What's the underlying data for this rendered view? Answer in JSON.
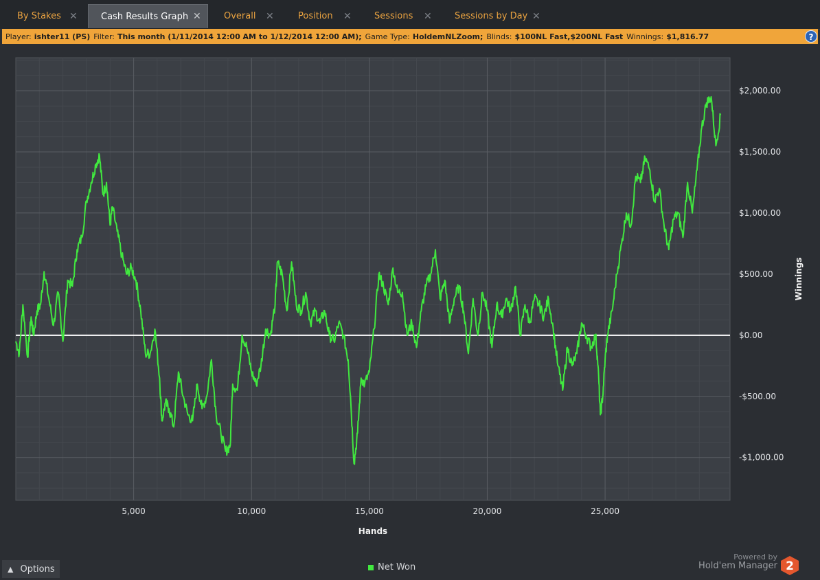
{
  "tabs": [
    {
      "label": "By Stakes",
      "active": false
    },
    {
      "label": "Cash Results Graph",
      "active": true
    },
    {
      "label": "Overall",
      "active": false
    },
    {
      "label": "Position",
      "active": false
    },
    {
      "label": "Sessions",
      "active": false
    },
    {
      "label": "Sessions by Day",
      "active": false
    }
  ],
  "filter": {
    "player_label": "Player:",
    "player_value": "ishter11 (PS)",
    "filter_label": "Filter:",
    "filter_value": "This month (1/11/2014 12:00 AM to 1/12/2014 12:00 AM);",
    "gametype_label": "Game Type:",
    "gametype_value": "HoldemNLZoom;",
    "blinds_label": "Blinds:",
    "blinds_value": "$100NL Fast,$200NL Fast",
    "winnings_label": "Winnings:",
    "winnings_value": "$1,816.77"
  },
  "help_label": "?",
  "options_label": "Options",
  "powered_by": "Powered by",
  "brand": "Hold'em Manager",
  "brand_badge": "2",
  "colors": {
    "line": "#41e83f",
    "zero": "#ffffff",
    "accent": "#f0a53a"
  },
  "chart_data": {
    "type": "line",
    "xlabel": "Hands",
    "ylabel": "Winnings",
    "xlim": [
      0,
      30300
    ],
    "ylim": [
      -1350,
      2270
    ],
    "xticks": [
      5000,
      10000,
      15000,
      20000,
      25000
    ],
    "xtick_labels": [
      "5,000",
      "10,000",
      "15,000",
      "20,000",
      "25,000"
    ],
    "yticks": [
      2000,
      1500,
      1000,
      500,
      0,
      -500,
      -1000
    ],
    "ytick_labels": [
      "$2,000.00",
      "$1,500.00",
      "$1,000.00",
      "$500.00",
      "$0.00",
      "-$500.00",
      "-$1,000.00"
    ],
    "grid": true,
    "legend": "bottom",
    "series": [
      {
        "name": "Net Won",
        "x": [
          0,
          150,
          300,
          500,
          650,
          750,
          900,
          1050,
          1200,
          1400,
          1600,
          1800,
          2000,
          2200,
          2400,
          2600,
          2800,
          3000,
          3200,
          3400,
          3550,
          3700,
          3850,
          4000,
          4100,
          4300,
          4500,
          4700,
          4900,
          5100,
          5300,
          5500,
          5700,
          5900,
          6100,
          6200,
          6350,
          6500,
          6700,
          6900,
          7100,
          7300,
          7500,
          7700,
          7900,
          8100,
          8300,
          8500,
          8700,
          8900,
          9100,
          9200,
          9400,
          9600,
          9800,
          10000,
          10200,
          10400,
          10600,
          10800,
          11000,
          11100,
          11300,
          11500,
          11700,
          11900,
          12100,
          12300,
          12500,
          12700,
          12900,
          13100,
          13300,
          13500,
          13700,
          13900,
          14100,
          14200,
          14350,
          14500,
          14650,
          14800,
          15000,
          15200,
          15400,
          15600,
          15800,
          16000,
          16200,
          16400,
          16600,
          16800,
          17000,
          17200,
          17400,
          17600,
          17800,
          18000,
          18200,
          18400,
          18600,
          18800,
          19000,
          19200,
          19400,
          19600,
          19800,
          20000,
          20200,
          20400,
          20600,
          20800,
          21000,
          21200,
          21400,
          21600,
          21800,
          22000,
          22200,
          22400,
          22600,
          22800,
          23000,
          23200,
          23400,
          23600,
          23800,
          24000,
          24200,
          24400,
          24600,
          24700,
          24800,
          24900,
          25000,
          25100,
          25300,
          25500,
          25700,
          25900,
          26100,
          26300,
          26500,
          26700,
          26900,
          27100,
          27300,
          27500,
          27700,
          27900,
          28100,
          28300,
          28500,
          28700,
          28900,
          29100,
          29300,
          29500,
          29700,
          29900
        ],
        "y": [
          -50,
          -150,
          250,
          -180,
          150,
          0,
          200,
          250,
          520,
          300,
          80,
          350,
          -50,
          450,
          400,
          700,
          800,
          1100,
          1250,
          1400,
          1470,
          1150,
          1250,
          900,
          1050,
          850,
          650,
          500,
          550,
          450,
          200,
          -150,
          -150,
          50,
          -350,
          -700,
          -550,
          -600,
          -750,
          -300,
          -500,
          -650,
          -700,
          -400,
          -600,
          -500,
          -200,
          -650,
          -800,
          -950,
          -900,
          -400,
          -450,
          0,
          -100,
          -300,
          -400,
          -250,
          50,
          0,
          250,
          600,
          500,
          200,
          600,
          250,
          200,
          350,
          100,
          200,
          100,
          200,
          0,
          -50,
          100,
          0,
          -200,
          -500,
          -1050,
          -800,
          -350,
          -400,
          -300,
          50,
          500,
          400,
          250,
          550,
          350,
          350,
          0,
          100,
          -100,
          200,
          400,
          500,
          700,
          300,
          450,
          100,
          300,
          400,
          200,
          -150,
          300,
          0,
          350,
          200,
          -100,
          250,
          150,
          300,
          200,
          400,
          0,
          250,
          100,
          300,
          250,
          150,
          300,
          50,
          -250,
          -450,
          -100,
          -250,
          -150,
          100,
          0,
          -100,
          0,
          -250,
          -650,
          -500,
          -200,
          0,
          200,
          500,
          750,
          1000,
          900,
          1300,
          1250,
          1450,
          1350,
          1100,
          1200,
          900,
          700,
          950,
          1000,
          800,
          1250,
          1000,
          1350,
          1700,
          1900,
          1950,
          1550,
          1800
        ]
      }
    ]
  }
}
